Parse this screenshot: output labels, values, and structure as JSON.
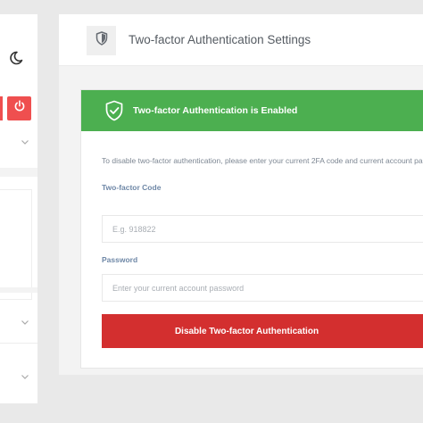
{
  "header": {
    "title": "Two-factor Authentication Settings",
    "icon": "shield-icon"
  },
  "alert": {
    "text": "Two-factor Authentication is Enabled",
    "icon": "shield-check-icon",
    "color": "#4caf50"
  },
  "form": {
    "instructions": "To disable two-factor authentication, please enter your current 2FA code and current account pa",
    "code_label": "Two-factor Code",
    "code_placeholder": "E.g. 918822",
    "password_label": "Password",
    "password_placeholder": "Enter your current account password",
    "submit_label": "Disable Two-factor Authentication",
    "submit_color": "#d32f2f"
  },
  "sidebar": {
    "theme_icon": "moon-icon",
    "power_icon": "power-icon",
    "power_color": "#ef4f4f",
    "expand_icon": "chevron-down-icon"
  }
}
